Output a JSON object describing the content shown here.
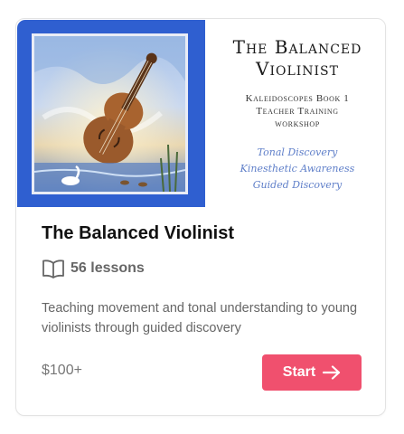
{
  "course": {
    "cover": {
      "title_line1": "The Balanced",
      "title_line2": "Violinist",
      "subtitle_line1": "Kaleidoscopes Book 1",
      "subtitle_line2": "Teacher Training",
      "subtitle_line3": "workshop",
      "script_line1": "Tonal Discovery",
      "script_line2": "Kinesthetic Awareness",
      "script_line3": "Guided Discovery",
      "accent_color": "#2f5fd0",
      "image_icon": "violin-painting"
    },
    "title": "The Balanced Violinist",
    "lessons": {
      "icon": "book-open-icon",
      "label": "56 lessons"
    },
    "description": "Teaching movement and tonal understanding to young violinists through guided discovery",
    "price": "$100+",
    "cta": {
      "label": "Start",
      "icon": "arrow-right-icon",
      "color": "#f0506e"
    }
  }
}
